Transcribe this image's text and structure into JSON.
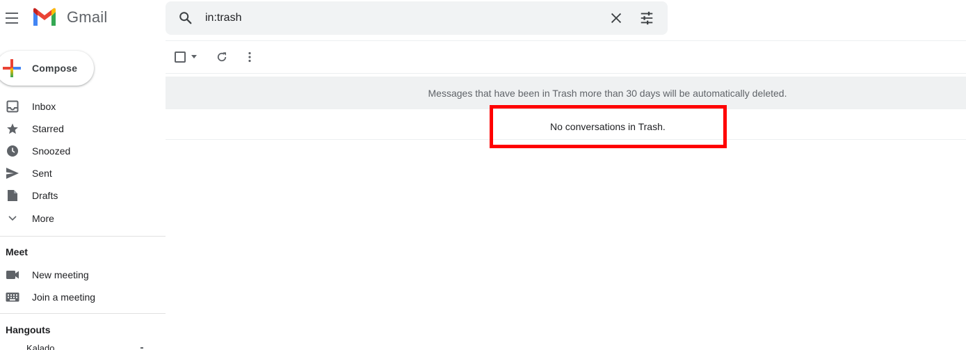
{
  "app": {
    "brand": "Gmail"
  },
  "search": {
    "value": "in:trash",
    "icon": "search-icon",
    "clear_icon": "close-icon",
    "options_icon": "tune-icon"
  },
  "sidebar": {
    "compose_label": "Compose",
    "items": [
      {
        "label": "Inbox",
        "icon": "inbox-icon"
      },
      {
        "label": "Starred",
        "icon": "star-icon"
      },
      {
        "label": "Snoozed",
        "icon": "clock-icon"
      },
      {
        "label": "Sent",
        "icon": "send-icon"
      },
      {
        "label": "Drafts",
        "icon": "draft-icon"
      },
      {
        "label": "More",
        "icon": "chevron-down-icon"
      }
    ],
    "meet": {
      "title": "Meet",
      "items": [
        {
          "label": "New meeting",
          "icon": "videocam-icon"
        },
        {
          "label": "Join a meeting",
          "icon": "keyboard-icon"
        }
      ]
    },
    "hangouts": {
      "title": "Hangouts",
      "user": "Kalado"
    }
  },
  "main": {
    "banner_text": "Messages that have been in Trash more than 30 days will be automatically deleted.",
    "empty_text": "No conversations in Trash."
  },
  "colors": {
    "highlight": "#ff0000",
    "banner_bg": "#eff1f2",
    "gmail_red": "#ea4335",
    "gmail_blue": "#4285f4",
    "gmail_green": "#34a853",
    "gmail_yellow": "#fbbc04"
  }
}
